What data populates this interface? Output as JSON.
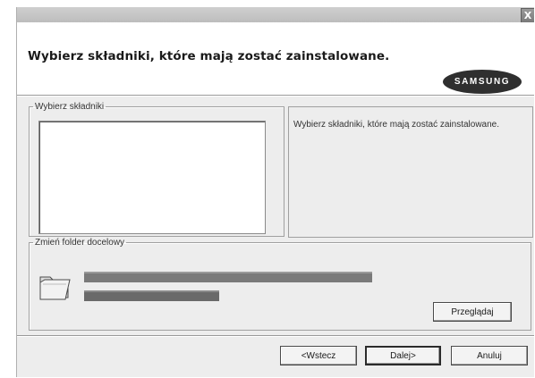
{
  "window": {
    "close_label": "X"
  },
  "header": {
    "title": "Wybierz składniki, które mają zostać zainstalowane.",
    "logo_text": "SAMSUNG"
  },
  "components": {
    "group_label": "Wybierz składniki",
    "description": "Wybierz składniki, które mają zostać zainstalowane."
  },
  "folder": {
    "group_label": "Zmień folder docelowy",
    "browse_label": "Przeglądaj"
  },
  "buttons": {
    "back_label": "<Wstecz",
    "next_label": "Dalej>",
    "cancel_label": "Anuluj"
  }
}
